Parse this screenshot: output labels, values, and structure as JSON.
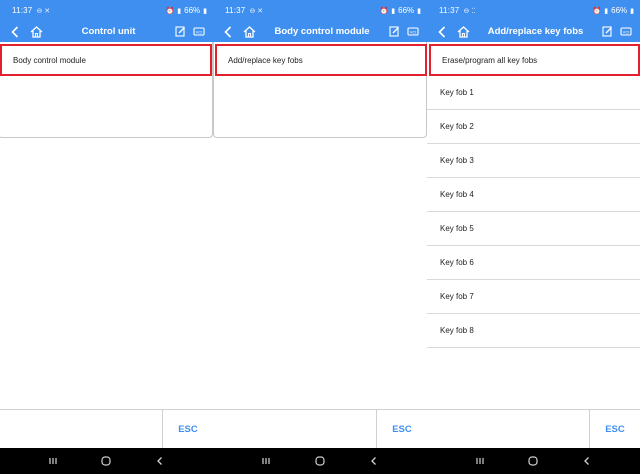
{
  "colors": {
    "accent": "#3f8ff0",
    "selection_border": "#e2202e",
    "nav_bar": "#000000",
    "esc_text": "#3f8ff0"
  },
  "status_bar": {
    "battery": "66%",
    "screens": [
      {
        "time": "11:37"
      },
      {
        "time": "11:37"
      },
      {
        "time": "11:37"
      }
    ]
  },
  "footer": {
    "esc_label": "ESC"
  },
  "screens": [
    {
      "title": "Control unit",
      "items": [
        {
          "label": "Body control module",
          "selected": true
        }
      ]
    },
    {
      "title": "Body control module",
      "items": [
        {
          "label": "Add/replace key fobs",
          "selected": true
        }
      ]
    },
    {
      "title": "Add/replace key fobs",
      "items": [
        {
          "label": "Erase/program all key fobs",
          "selected": true
        },
        {
          "label": "Key fob 1",
          "selected": false
        },
        {
          "label": "Key fob 2",
          "selected": false
        },
        {
          "label": "Key fob 3",
          "selected": false
        },
        {
          "label": "Key fob 4",
          "selected": false
        },
        {
          "label": "Key fob 5",
          "selected": false
        },
        {
          "label": "Key fob 6",
          "selected": false
        },
        {
          "label": "Key fob 7",
          "selected": false
        },
        {
          "label": "Key fob 8",
          "selected": false
        }
      ]
    }
  ],
  "icons": {
    "back": "chevron-left-icon",
    "home": "home-icon",
    "edit": "edit-icon",
    "vci": "vci-connector-icon",
    "nav_recents": "recents-icon",
    "nav_home": "nav-home-icon",
    "nav_back": "nav-back-icon"
  }
}
